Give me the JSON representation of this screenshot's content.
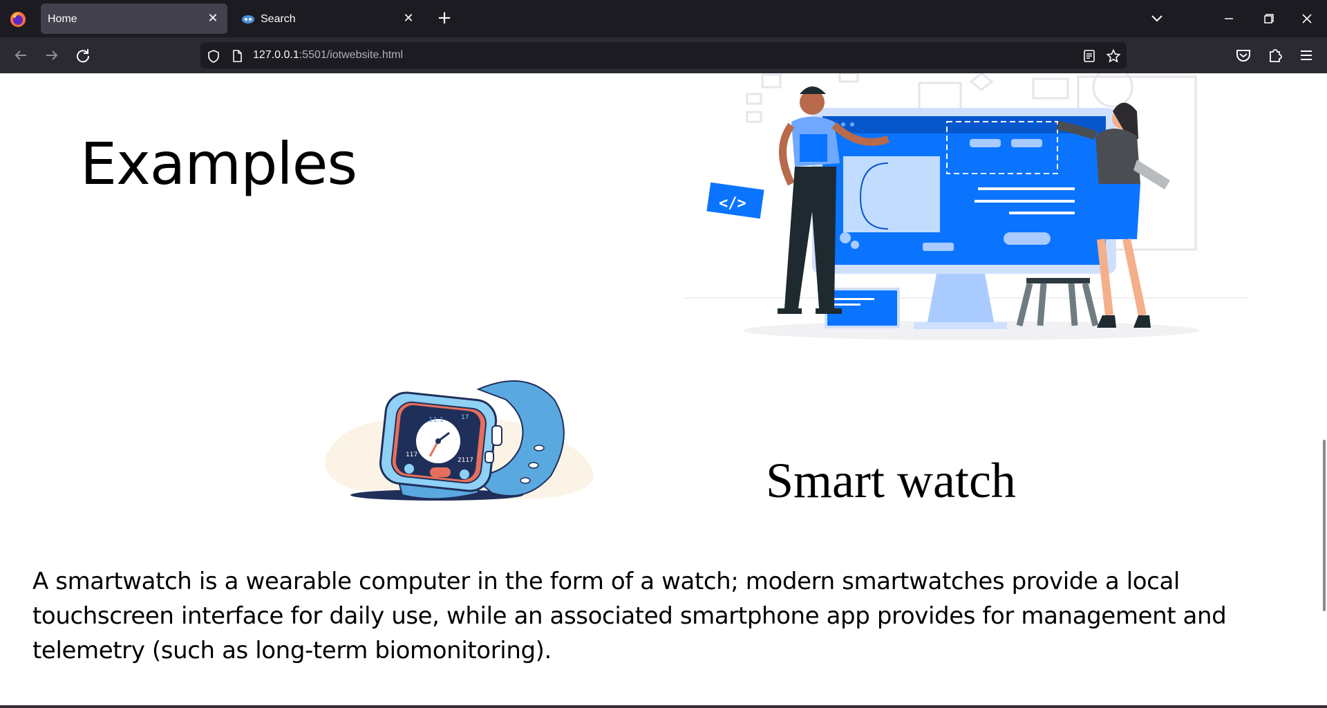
{
  "browser": {
    "tabs": [
      {
        "title": "Home",
        "active": true
      },
      {
        "title": "Search",
        "active": false
      }
    ],
    "url_host": "127.0.0.1",
    "url_rest": ":5501/iotwebsite.html",
    "icons": {
      "logo": "firefox-icon",
      "back": "arrow-left-icon",
      "forward": "arrow-right-icon",
      "reload": "reload-icon",
      "shield": "shield-icon",
      "page": "page-icon",
      "reader": "reader-view-icon",
      "bookmark": "star-icon",
      "pocket": "pocket-icon",
      "extensions": "puzzle-icon",
      "menu": "hamburger-menu-icon"
    },
    "colors": {
      "tabstrip": "#1c1b22",
      "navbar": "#2b2a33",
      "active_tab": "#42414d"
    }
  },
  "page": {
    "examples_heading": "Examples",
    "smartwatch_heading": "Smart watch",
    "smartwatch_paragraph": "A smartwatch is a wearable computer in the form of a watch; modern smartwatches provide a local touchscreen interface for daily use, while an associated smartphone app provides for management and telemetry (such as long-term biomonitoring).",
    "watch_face": {
      "time": "11.1",
      "small_left": "117",
      "small_right": "2117",
      "top_right": "17"
    },
    "accent_color": "#0a74ff"
  }
}
